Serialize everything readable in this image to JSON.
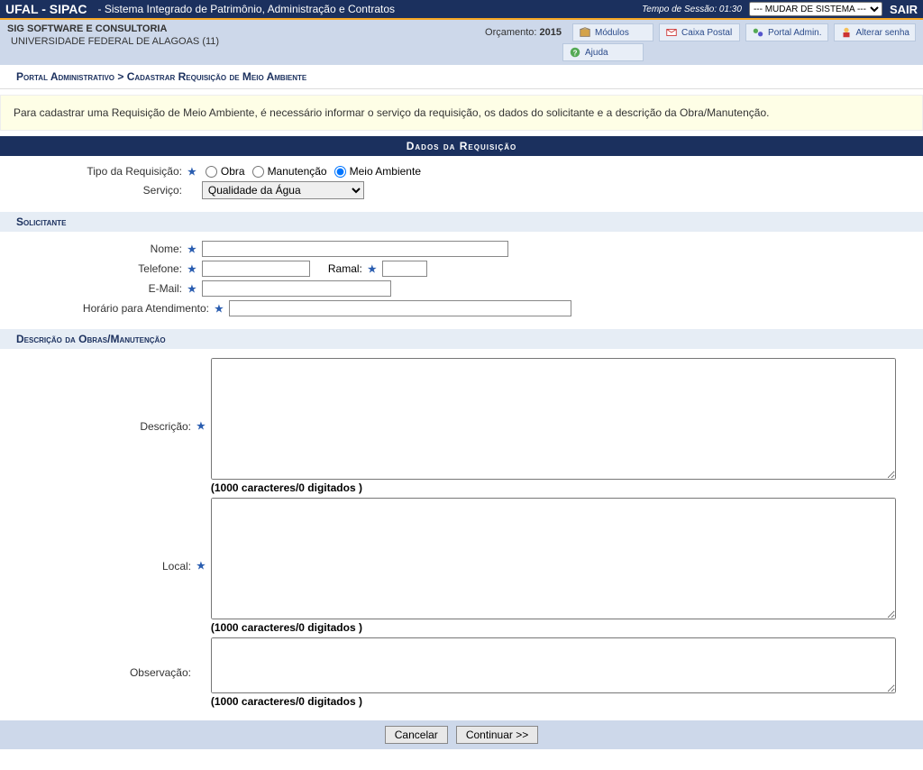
{
  "topbar": {
    "title": "UFAL - SIPAC",
    "subtitle": "-   Sistema Integrado de Patrimônio, Administração e Contratos",
    "session_label": "Tempo de Sessão:",
    "session_time": "01:30",
    "system_select": "--- MUDAR DE SISTEMA ---",
    "sair": "SAIR"
  },
  "infobar": {
    "org": "SIG SOFTWARE E CONSULTORIA",
    "univ": "UNIVERSIDADE FEDERAL DE ALAGOAS (11)",
    "orcamento_label": "Orçamento:",
    "orcamento_year": "2015",
    "links": {
      "modulos": "Módulos",
      "caixa": "Caixa Postal",
      "portal": "Portal Admin.",
      "alterar": "Alterar senha",
      "ajuda": "Ajuda"
    }
  },
  "breadcrumb": "Portal Administrativo > Cadastrar Requisição de Meio Ambiente",
  "instruction": "Para cadastrar uma Requisição de Meio Ambiente, é necessário informar o serviço da requisição, os dados do solicitante e a descrição da Obra/Manutenção.",
  "section_header": "Dados da Requisição",
  "form": {
    "tipo_label": "Tipo da Requisição:",
    "tipo_options": {
      "obra": "Obra",
      "manutencao": "Manutenção",
      "meio": "Meio Ambiente"
    },
    "servico_label": "Serviço:",
    "servico_value": "Qualidade da Água"
  },
  "solicitante": {
    "header": "Solicitante",
    "nome": "Nome:",
    "telefone": "Telefone:",
    "ramal": "Ramal:",
    "email": "E-Mail:",
    "horario": "Horário para Atendimento:"
  },
  "descricao": {
    "header": "Descrição da Obras/Manutenção",
    "descricao_label": "Descrição:",
    "local_label": "Local:",
    "observacao_label": "Observação:",
    "counter": "(1000 caracteres/0 digitados )"
  },
  "buttons": {
    "cancelar": "Cancelar",
    "continuar": "Continuar >>"
  }
}
